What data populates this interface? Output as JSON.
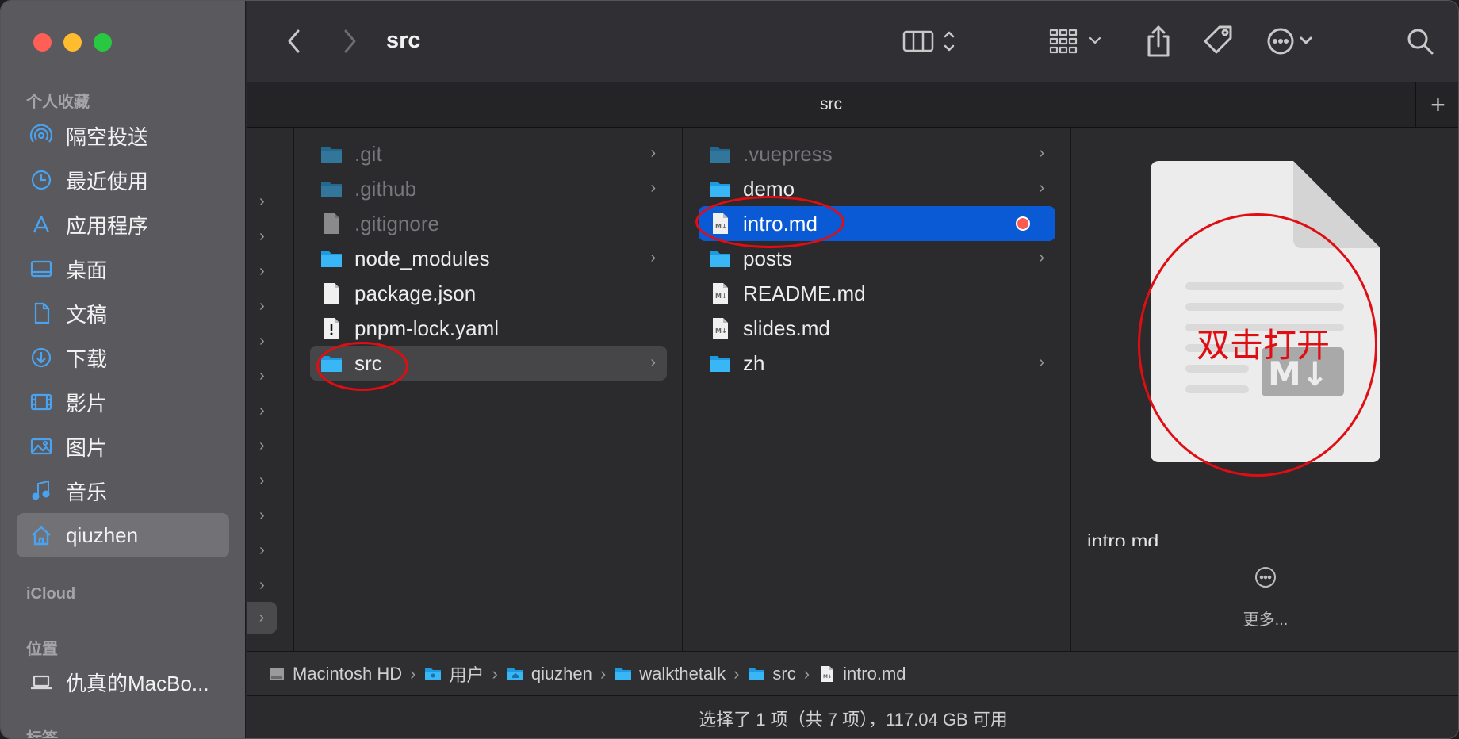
{
  "window": {
    "title": "src"
  },
  "toolbar": {
    "back_icon": "chevron-left-icon",
    "forward_icon": "chevron-right-icon"
  },
  "tabbar": {
    "tab_title": "src",
    "add_tab_label": "+"
  },
  "sidebar": {
    "favorites_header": "个人收藏",
    "favorites": [
      {
        "label": "隔空投送",
        "icon": "airdrop-icon"
      },
      {
        "label": "最近使用",
        "icon": "clock-icon"
      },
      {
        "label": "应用程序",
        "icon": "apps-icon"
      },
      {
        "label": "桌面",
        "icon": "desktop-icon"
      },
      {
        "label": "文稿",
        "icon": "document-icon"
      },
      {
        "label": "下载",
        "icon": "download-icon"
      },
      {
        "label": "影片",
        "icon": "film-icon"
      },
      {
        "label": "图片",
        "icon": "photo-icon"
      },
      {
        "label": "音乐",
        "icon": "music-icon"
      },
      {
        "label": "qiuzhen",
        "icon": "home-icon"
      }
    ],
    "icloud_header": "iCloud",
    "locations_header": "位置",
    "locations": [
      {
        "label": "仇真的MacBo...",
        "icon": "laptop-icon"
      }
    ],
    "tags_header": "标签"
  },
  "column1": {
    "items": [
      {
        "name": ".git",
        "type": "folder",
        "hidden": true
      },
      {
        "name": ".github",
        "type": "folder",
        "hidden": true
      },
      {
        "name": ".gitignore",
        "type": "file",
        "hidden": true
      },
      {
        "name": "node_modules",
        "type": "folder"
      },
      {
        "name": "package.json",
        "type": "file"
      },
      {
        "name": "pnpm-lock.yaml",
        "type": "yaml"
      },
      {
        "name": "src",
        "type": "folder",
        "highlighted": true
      }
    ]
  },
  "column2": {
    "items": [
      {
        "name": ".vuepress",
        "type": "folder",
        "hidden": true
      },
      {
        "name": "demo",
        "type": "folder"
      },
      {
        "name": "intro.md",
        "type": "markdown",
        "selected": true,
        "tag_color": "#ff5a52"
      },
      {
        "name": "posts",
        "type": "folder"
      },
      {
        "name": "README.md",
        "type": "markdown"
      },
      {
        "name": "slides.md",
        "type": "markdown"
      },
      {
        "name": "zh",
        "type": "folder"
      }
    ]
  },
  "preview": {
    "file_name": "intro.md",
    "more_label": "更多..."
  },
  "annotation": {
    "text": "双击打开",
    "color": "#e00d12"
  },
  "pathbar": {
    "crumbs": [
      {
        "label": "Macintosh HD",
        "icon": "disk-icon"
      },
      {
        "label": "用户",
        "icon": "folder-icon"
      },
      {
        "label": "qiuzhen",
        "icon": "home-folder-icon"
      },
      {
        "label": "walkthetalk",
        "icon": "folder-icon"
      },
      {
        "label": "src",
        "icon": "folder-icon"
      },
      {
        "label": "intro.md",
        "icon": "markdown-file-icon"
      }
    ]
  },
  "status": {
    "text": "选择了 1 项（共 7 项），117.04 GB 可用"
  }
}
